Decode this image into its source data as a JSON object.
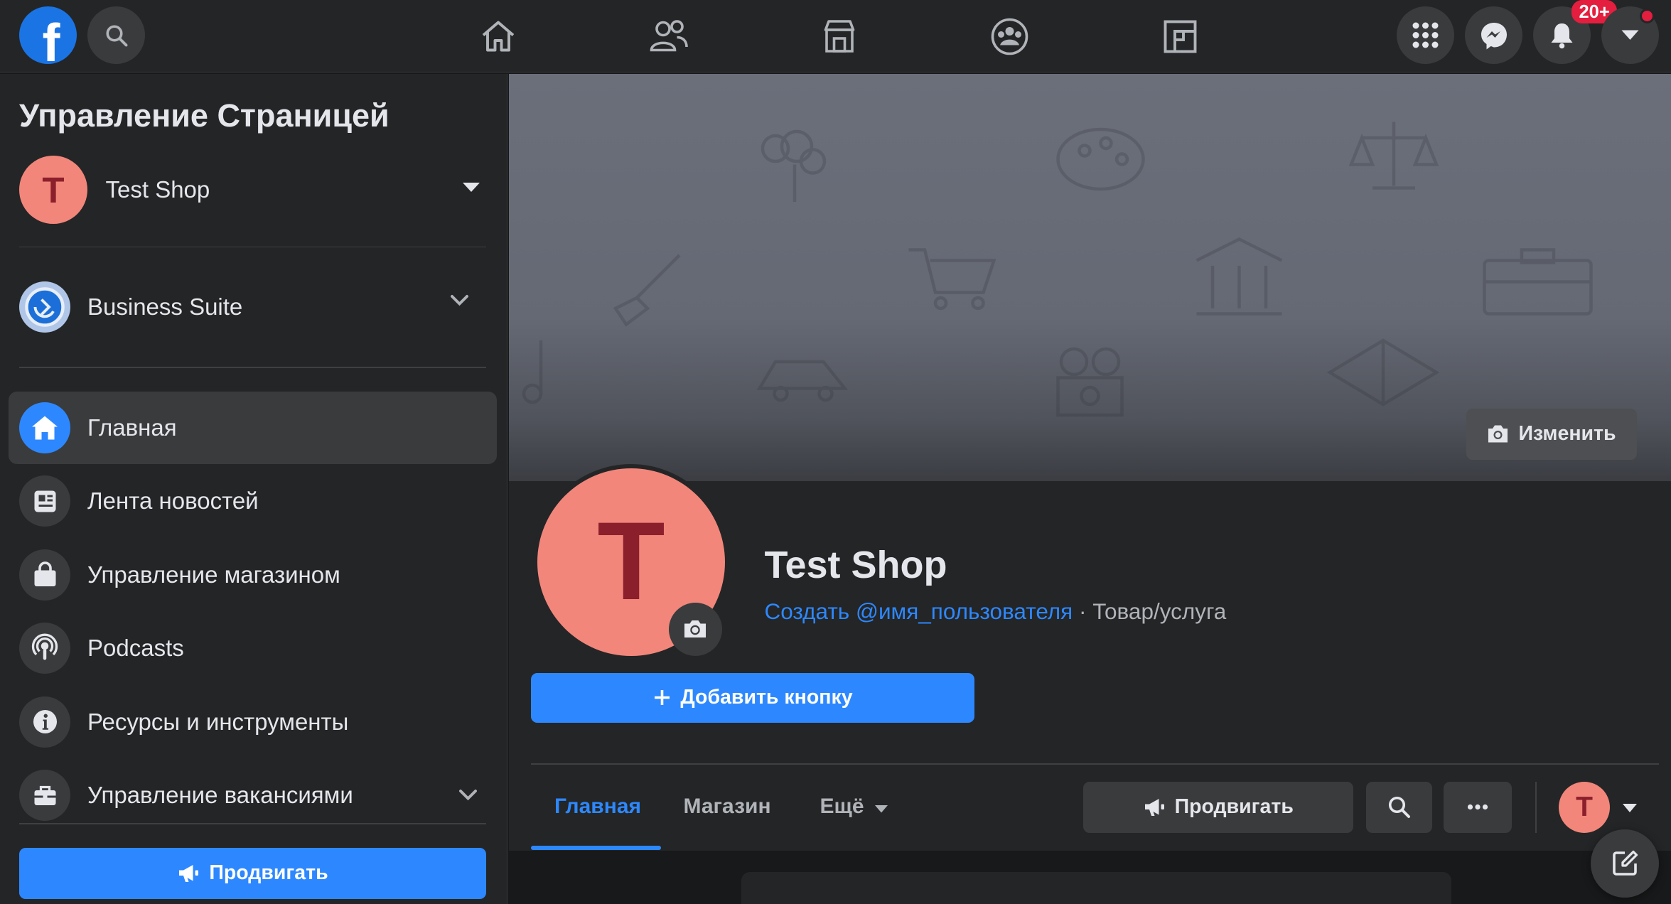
{
  "topbar": {
    "logo": "facebook-logo",
    "search_icon": "search-icon",
    "nav": [
      "home-icon",
      "friends-icon",
      "marketplace-icon",
      "groups-icon",
      "gaming-icon"
    ],
    "right": [
      "menu-grid-icon",
      "messenger-icon",
      "notifications-icon",
      "account-caret-icon"
    ],
    "notifications_badge": "20+"
  },
  "sidebar": {
    "title": "Управление Страницей",
    "page": {
      "initial": "T",
      "name": "Test Shop"
    },
    "business_suite": "Business Suite",
    "items": [
      {
        "label": "Главная",
        "icon": "home-icon",
        "active": true
      },
      {
        "label": "Лента новостей",
        "icon": "news-feed-icon"
      },
      {
        "label": "Управление магазином",
        "icon": "shopping-bag-icon"
      },
      {
        "label": "Podcasts",
        "icon": "podcast-icon"
      },
      {
        "label": "Ресурсы и инструменты",
        "icon": "info-icon"
      },
      {
        "label": "Управление вакансиями",
        "icon": "briefcase-icon"
      }
    ],
    "promote_label": "Продвигать"
  },
  "main": {
    "edit_cover_label": "Изменить",
    "profile_initial": "T",
    "page_name": "Test Shop",
    "username_link": "Создать @имя_пользователя",
    "separator": " · ",
    "category": "Товар/услуга",
    "add_button_label": "Добавить кнопку",
    "tabs": [
      {
        "label": "Главная",
        "active": true
      },
      {
        "label": "Магазин"
      },
      {
        "label": "Ещё"
      }
    ],
    "promote_label": "Продвигать",
    "avatar_initial": "T"
  },
  "colors": {
    "accent": "#2d88ff",
    "avatar_bg": "#f2867b",
    "avatar_fg": "#8b1f2b",
    "badge": "#e41e3f"
  }
}
